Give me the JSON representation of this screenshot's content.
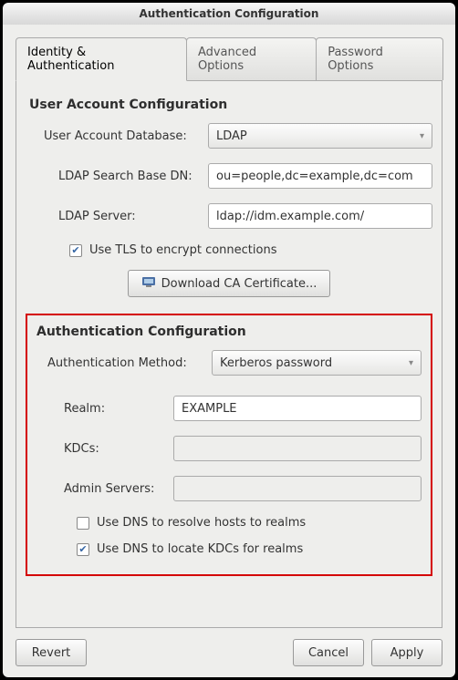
{
  "window": {
    "title": "Authentication Configuration"
  },
  "tabs": [
    {
      "label": "Identity & Authentication",
      "active": true
    },
    {
      "label": "Advanced Options",
      "active": false
    },
    {
      "label": "Password Options",
      "active": false
    }
  ],
  "userSection": {
    "title": "User Account Configuration",
    "databaseLabel": "User Account Database:",
    "databaseValue": "LDAP",
    "searchBaseLabel": "LDAP Search Base DN:",
    "searchBaseValue": "ou=people,dc=example,dc=com",
    "serverLabel": "LDAP Server:",
    "serverValue": "ldap://idm.example.com/",
    "tlsLabel": "Use TLS to encrypt connections",
    "downloadLabel": "Download CA Certificate..."
  },
  "authSection": {
    "title": "Authentication Configuration",
    "methodLabel": "Authentication Method:",
    "methodValue": "Kerberos password",
    "realmLabel": "Realm:",
    "realmValue": "EXAMPLE",
    "kdcsLabel": "KDCs:",
    "kdcsValue": "",
    "adminLabel": "Admin Servers:",
    "adminValue": "",
    "dnsResolveLabel": "Use DNS to resolve hosts to realms",
    "dnsLocateLabel": "Use DNS to locate KDCs for realms"
  },
  "buttons": {
    "revert": "Revert",
    "cancel": "Cancel",
    "apply": "Apply"
  }
}
